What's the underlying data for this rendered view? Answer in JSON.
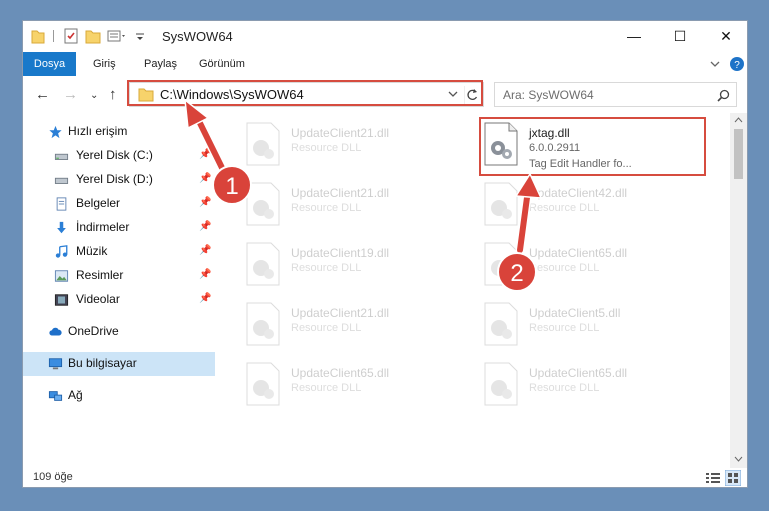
{
  "window": {
    "title": "SysWOW64"
  },
  "ribbon": {
    "tabs": [
      "Dosya",
      "Giriş",
      "Paylaş",
      "Görünüm"
    ]
  },
  "address": {
    "path": "C:\\Windows\\SysWOW64"
  },
  "search": {
    "placeholder": "Ara: SysWOW64"
  },
  "sidebar": {
    "items": [
      {
        "label": "Hızlı erişim",
        "icon": "star-icon"
      },
      {
        "label": "Yerel Disk (C:)",
        "icon": "drive-icon"
      },
      {
        "label": "Yerel Disk (D:)",
        "icon": "drive-icon"
      },
      {
        "label": "Belgeler",
        "icon": "documents-icon"
      },
      {
        "label": "İndirmeler",
        "icon": "download-icon"
      },
      {
        "label": "Müzik",
        "icon": "music-icon"
      },
      {
        "label": "Resimler",
        "icon": "pictures-icon"
      },
      {
        "label": "Videolar",
        "icon": "video-icon"
      },
      {
        "label": "OneDrive",
        "icon": "cloud-icon"
      },
      {
        "label": "Bu bilgisayar",
        "icon": "computer-icon"
      },
      {
        "label": "Ağ",
        "icon": "network-icon"
      }
    ]
  },
  "files": {
    "left": [
      {
        "name": "UpdateClient21.dll",
        "type": "Resource DLL"
      },
      {
        "name": "UpdateClient21.dll",
        "type": "Resource DLL"
      },
      {
        "name": "UpdateClient19.dll",
        "type": "Resource DLL"
      },
      {
        "name": "UpdateClient21.dll",
        "type": "Resource DLL"
      },
      {
        "name": "UpdateClient65.dll",
        "type": "Resource DLL"
      }
    ],
    "highlight": {
      "name": "jxtag.dll",
      "version": "6.0.0.2911",
      "description": "Tag Edit Handler fo..."
    },
    "right": [
      {
        "name": "UpdateClient42.dll",
        "type": "Resource DLL"
      },
      {
        "name": "UpdateClient65.dll",
        "type": "Resource DLL"
      },
      {
        "name": "UpdateClient5.dll",
        "type": "Resource DLL"
      },
      {
        "name": "UpdateClient65.dll",
        "type": "Resource DLL"
      }
    ]
  },
  "status": {
    "count": "109 öğe"
  },
  "annotations": {
    "step1": "1",
    "step2": "2"
  }
}
